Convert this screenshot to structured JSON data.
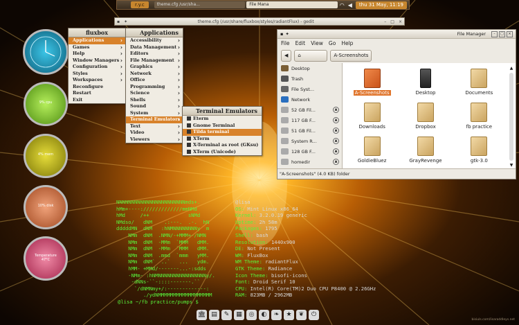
{
  "top_panel": {
    "workspace": "r.y.c",
    "tasks": [
      "theme.cfg /usr/sha...",
      "File Mana"
    ],
    "clock": "thu 31 May, 11:19"
  },
  "gedit": {
    "title": "theme.cfg (/usr/share/fluxbox/styles/radiantFlux) - gedit"
  },
  "gauges": [
    {
      "name": "clock",
      "text": ""
    },
    {
      "name": "cpu",
      "text": "9% cpu"
    },
    {
      "name": "mem",
      "text": "4% mem"
    },
    {
      "name": "disk",
      "text": "10% disk"
    },
    {
      "name": "temperature",
      "text": "Temperature 47°C"
    }
  ],
  "fluxbox_menu": {
    "title": "fluxbox",
    "items": [
      "Applications",
      "Games",
      "Help",
      "Window Managers",
      "Configuration",
      "Styles",
      "Workspaces",
      "Reconfigure",
      "Restart",
      "Exit"
    ],
    "highlight": 0
  },
  "applications_menu": {
    "title": "Applications",
    "items": [
      "Accessibility",
      "Data Management",
      "Editors",
      "File Management",
      "Graphics",
      "Network",
      "Office",
      "Programming",
      "Science",
      "Shells",
      "Sound",
      "System",
      "Terminal Emulators",
      "Text",
      "Video",
      "Viewers"
    ],
    "highlight": 12
  },
  "terminal_menu": {
    "title": "Terminal Emulators",
    "items": [
      "Eterm",
      "Gnome Terminal",
      "Tilda terminal",
      "XTerm",
      "X-Terminal as root (GKsu)",
      "XTerm (Unicode)"
    ],
    "highlight": 2
  },
  "file_manager": {
    "title": "File Manager",
    "menubar": [
      "File",
      "Edit",
      "View",
      "Go",
      "Help"
    ],
    "path": [
      "A-Screenshots"
    ],
    "sidebar": [
      {
        "label": "Desktop",
        "eject": false
      },
      {
        "label": "Trash",
        "eject": false
      },
      {
        "label": "File Syst...",
        "eject": false
      },
      {
        "label": "Network",
        "eject": false
      },
      {
        "label": "52 GB Fil...",
        "eject": true
      },
      {
        "label": "117 GB F...",
        "eject": true
      },
      {
        "label": "51 GB Fil...",
        "eject": true
      },
      {
        "label": "System R...",
        "eject": true
      },
      {
        "label": "128 GB F...",
        "eject": true
      },
      {
        "label": "homedir",
        "eject": true
      }
    ],
    "files": [
      {
        "label": "A-Screenshots",
        "selected": true,
        "kind": "orange"
      },
      {
        "label": "Desktop",
        "selected": false,
        "kind": "desktop"
      },
      {
        "label": "Documents",
        "selected": false,
        "kind": "folder"
      },
      {
        "label": "Downloads",
        "selected": false,
        "kind": "folder"
      },
      {
        "label": "Dropbox",
        "selected": false,
        "kind": "folder"
      },
      {
        "label": "fb practice",
        "selected": false,
        "kind": "folder"
      },
      {
        "label": "GoldieBluez",
        "selected": false,
        "kind": "folder"
      },
      {
        "label": "GrayRevenge",
        "selected": false,
        "kind": "folder"
      },
      {
        "label": "gtk-3.0",
        "selected": false,
        "kind": "folder"
      }
    ],
    "status": "\"A-Screenshots\" (4.0 KB) folder"
  },
  "terminal": {
    "lines": [
      {
        "art": "NNNNNNNNNNNNNNNNNNNNNNNmds+.   ",
        "k": "",
        "v": "@lisa"
      },
      {
        "art": "hMm+----://///////////mmNMd    ",
        "k": "OS: ",
        "v": "Mint Linux x86_64"
      },
      {
        "art": "hMd     /++             sNMd   ",
        "k": "Kernel: ",
        "v": "3.2.0.19 generic"
      },
      {
        "art": "NMdso/   dNM    .:---.  .-.  hN",
        "k": "Uptime: ",
        "v": "2h 58m"
      },
      {
        "art": "dddddMN  dNM   :hNMNNNNNNNNy  m",
        "k": "Packages: ",
        "v": "1795"
      },
      {
        "art": "    NMm  dNM  .NMN/-+MMM+-/NMN ",
        "k": "Shell: ",
        "v": "bash"
      },
      {
        "art": "    NMm  dNM  -MMm  `MMM   dMM.",
        "k": "Resolution: ",
        "v": "1440x900"
      },
      {
        "art": "    NMm  dNM  -MMm  `MMM   dMM.",
        "k": "DE: ",
        "v": "Not Present"
      },
      {
        "art": "    NMm  dNM  .mmd  `mmm   yMM.",
        "k": "WM: ",
        "v": "FluxBox"
      },
      {
        "art": "    NMm  dNM`  ..`   ...   ydm.",
        "k": "WM Theme: ",
        "v": "radiantFlux"
      },
      {
        "art": "    hMM- +MMd/-------...-:sdds ",
        "k": "GTK Theme: ",
        "v": "Radiance"
      },
      {
        "art": "    -NMm- :hNMNNNNNNNNNNNNNNNNy/.",
        "k": "Icon Theme: ",
        "v": "bisofi-icons"
      },
      {
        "art": "     -dNNs-``-::::-------.``   ",
        "k": "Font: ",
        "v": "Droid Serif 10"
      },
      {
        "art": "      `/dNMNmy+/:-------------:",
        "k": "CPU: ",
        "v": "Intel(R) Core(TM)2 Duo CPU P8400 @ 2.26GHz"
      },
      {
        "art": "         ./ydNMMMMMMMMMMMMMMMMMM",
        "k": "RAM: ",
        "v": "823MB / 2962MB"
      }
    ],
    "prompt": "@lisa ~/fb practice/pumps $"
  },
  "dock": [
    "🏛",
    "▤",
    "✎",
    "▦",
    "◎",
    "◐",
    "❧",
    "★",
    "❦",
    "⏻"
  ],
  "credit": "bisiuls.com/lisaraddleys.net"
}
